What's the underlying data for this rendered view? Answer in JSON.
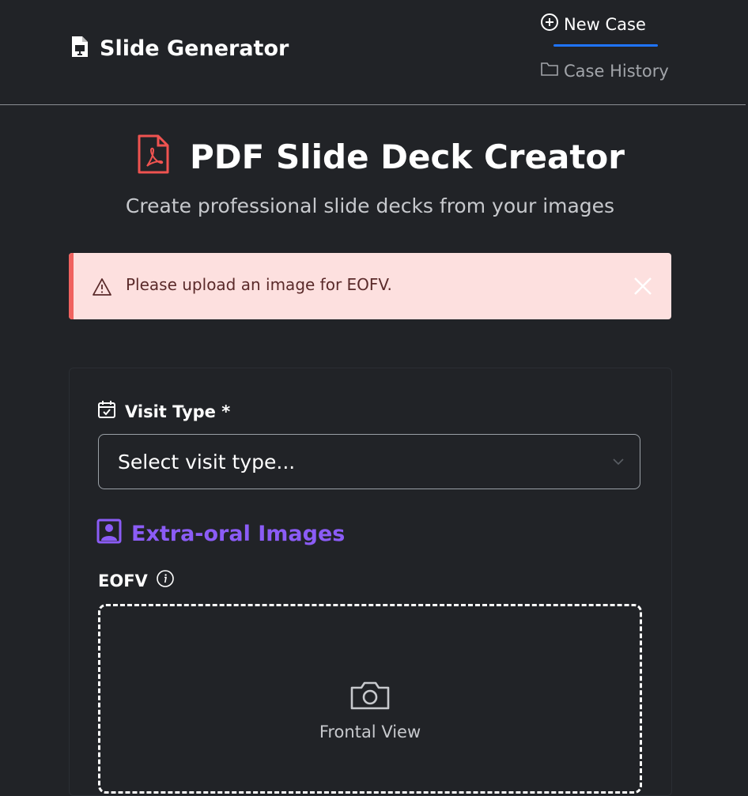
{
  "app": {
    "title": "Slide Generator"
  },
  "nav": {
    "new_case": "New Case",
    "case_history": "Case History"
  },
  "hero": {
    "title": "PDF Slide Deck Creator",
    "subtitle": "Create professional slide decks from your images"
  },
  "alert": {
    "message": "Please upload an image for EOFV."
  },
  "form": {
    "visit_type_label": "Visit Type *",
    "visit_type_placeholder": "Select visit type...",
    "section_title": "Extra-oral Images",
    "eofv_label": "EOFV",
    "dropzone_text": "Frontal View"
  },
  "colors": {
    "accent": "#1f74ff",
    "section": "#8b5cf6",
    "alert_bg": "#fde0df",
    "alert_bar": "#f0625f",
    "pdf_icon": "#ef5350"
  }
}
